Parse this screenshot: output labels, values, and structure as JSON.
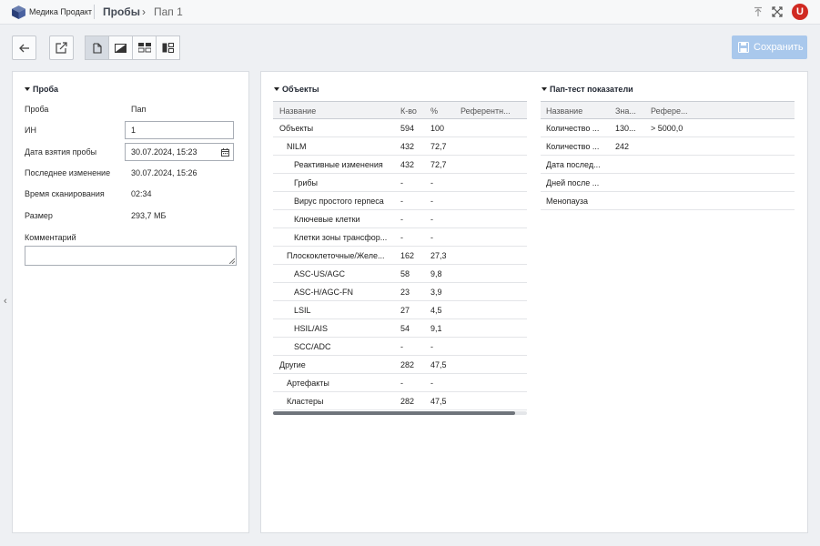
{
  "header": {
    "brand": "Медика Продакт",
    "crumbs": [
      "Пробы",
      "Пап 1"
    ],
    "user_initial": "U",
    "user_color": "#d02a22"
  },
  "toolbar": {
    "save_label": "Сохранить",
    "save_color": "#a9c8ec"
  },
  "probe": {
    "title": "Проба",
    "fields": [
      {
        "label": "Проба",
        "value": "Пап"
      },
      {
        "label": "ИН",
        "value": "1"
      },
      {
        "label": "Дата взятия пробы",
        "value": "30.07.2024, 15:23"
      },
      {
        "label": "Последнее изменение",
        "value": "30.07.2024, 15:26"
      },
      {
        "label": "Время сканирования",
        "value": "02:34"
      },
      {
        "label": "Размер",
        "value": "293,7 МБ"
      },
      {
        "label": "Комментарий",
        "value": ""
      }
    ]
  },
  "objects": {
    "title": "Объекты",
    "columns": [
      "Название",
      "К-во",
      "%",
      "Референтн..."
    ],
    "rows": [
      {
        "name": "Объекты",
        "count": "594",
        "pct": "100",
        "indent": 0
      },
      {
        "name": "NILM",
        "count": "432",
        "pct": "72,7",
        "indent": 1
      },
      {
        "name": "Реактивные изменения",
        "count": "432",
        "pct": "72,7",
        "indent": 2
      },
      {
        "name": "Грибы",
        "count": "-",
        "pct": "-",
        "indent": 2
      },
      {
        "name": "Вирус простого герпеса",
        "count": "-",
        "pct": "-",
        "indent": 2
      },
      {
        "name": "Ключевые клетки",
        "count": "-",
        "pct": "-",
        "indent": 2
      },
      {
        "name": "Клетки зоны трансфор...",
        "count": "-",
        "pct": "-",
        "indent": 2
      },
      {
        "name": "Плоскоклеточные/Желе...",
        "count": "162",
        "pct": "27,3",
        "indent": 1
      },
      {
        "name": "ASC-US/AGC",
        "count": "58",
        "pct": "9,8",
        "indent": 2
      },
      {
        "name": "ASC-H/AGC-FN",
        "count": "23",
        "pct": "3,9",
        "indent": 2
      },
      {
        "name": "LSIL",
        "count": "27",
        "pct": "4,5",
        "indent": 2
      },
      {
        "name": "HSIL/AIS",
        "count": "54",
        "pct": "9,1",
        "indent": 2
      },
      {
        "name": "SCC/ADC",
        "count": "-",
        "pct": "-",
        "indent": 2
      },
      {
        "name": "Другие",
        "count": "282",
        "pct": "47,5",
        "indent": 0
      },
      {
        "name": "Артефакты",
        "count": "-",
        "pct": "-",
        "indent": 1
      },
      {
        "name": "Кластеры",
        "count": "282",
        "pct": "47,5",
        "indent": 1
      }
    ]
  },
  "paptest": {
    "title": "Пап-тест показатели",
    "columns": [
      "Название",
      "Зна...",
      "Рефере..."
    ],
    "rows": [
      {
        "name": "Количество ...",
        "value": "130...",
        "ref": "> 5000,0"
      },
      {
        "name": "Количество ...",
        "value": "242",
        "ref": ""
      },
      {
        "name": "Дата послед...",
        "value": "",
        "ref": ""
      },
      {
        "name": "Дней после ...",
        "value": "",
        "ref": ""
      },
      {
        "name": "Менопауза",
        "value": "",
        "ref": ""
      }
    ]
  }
}
